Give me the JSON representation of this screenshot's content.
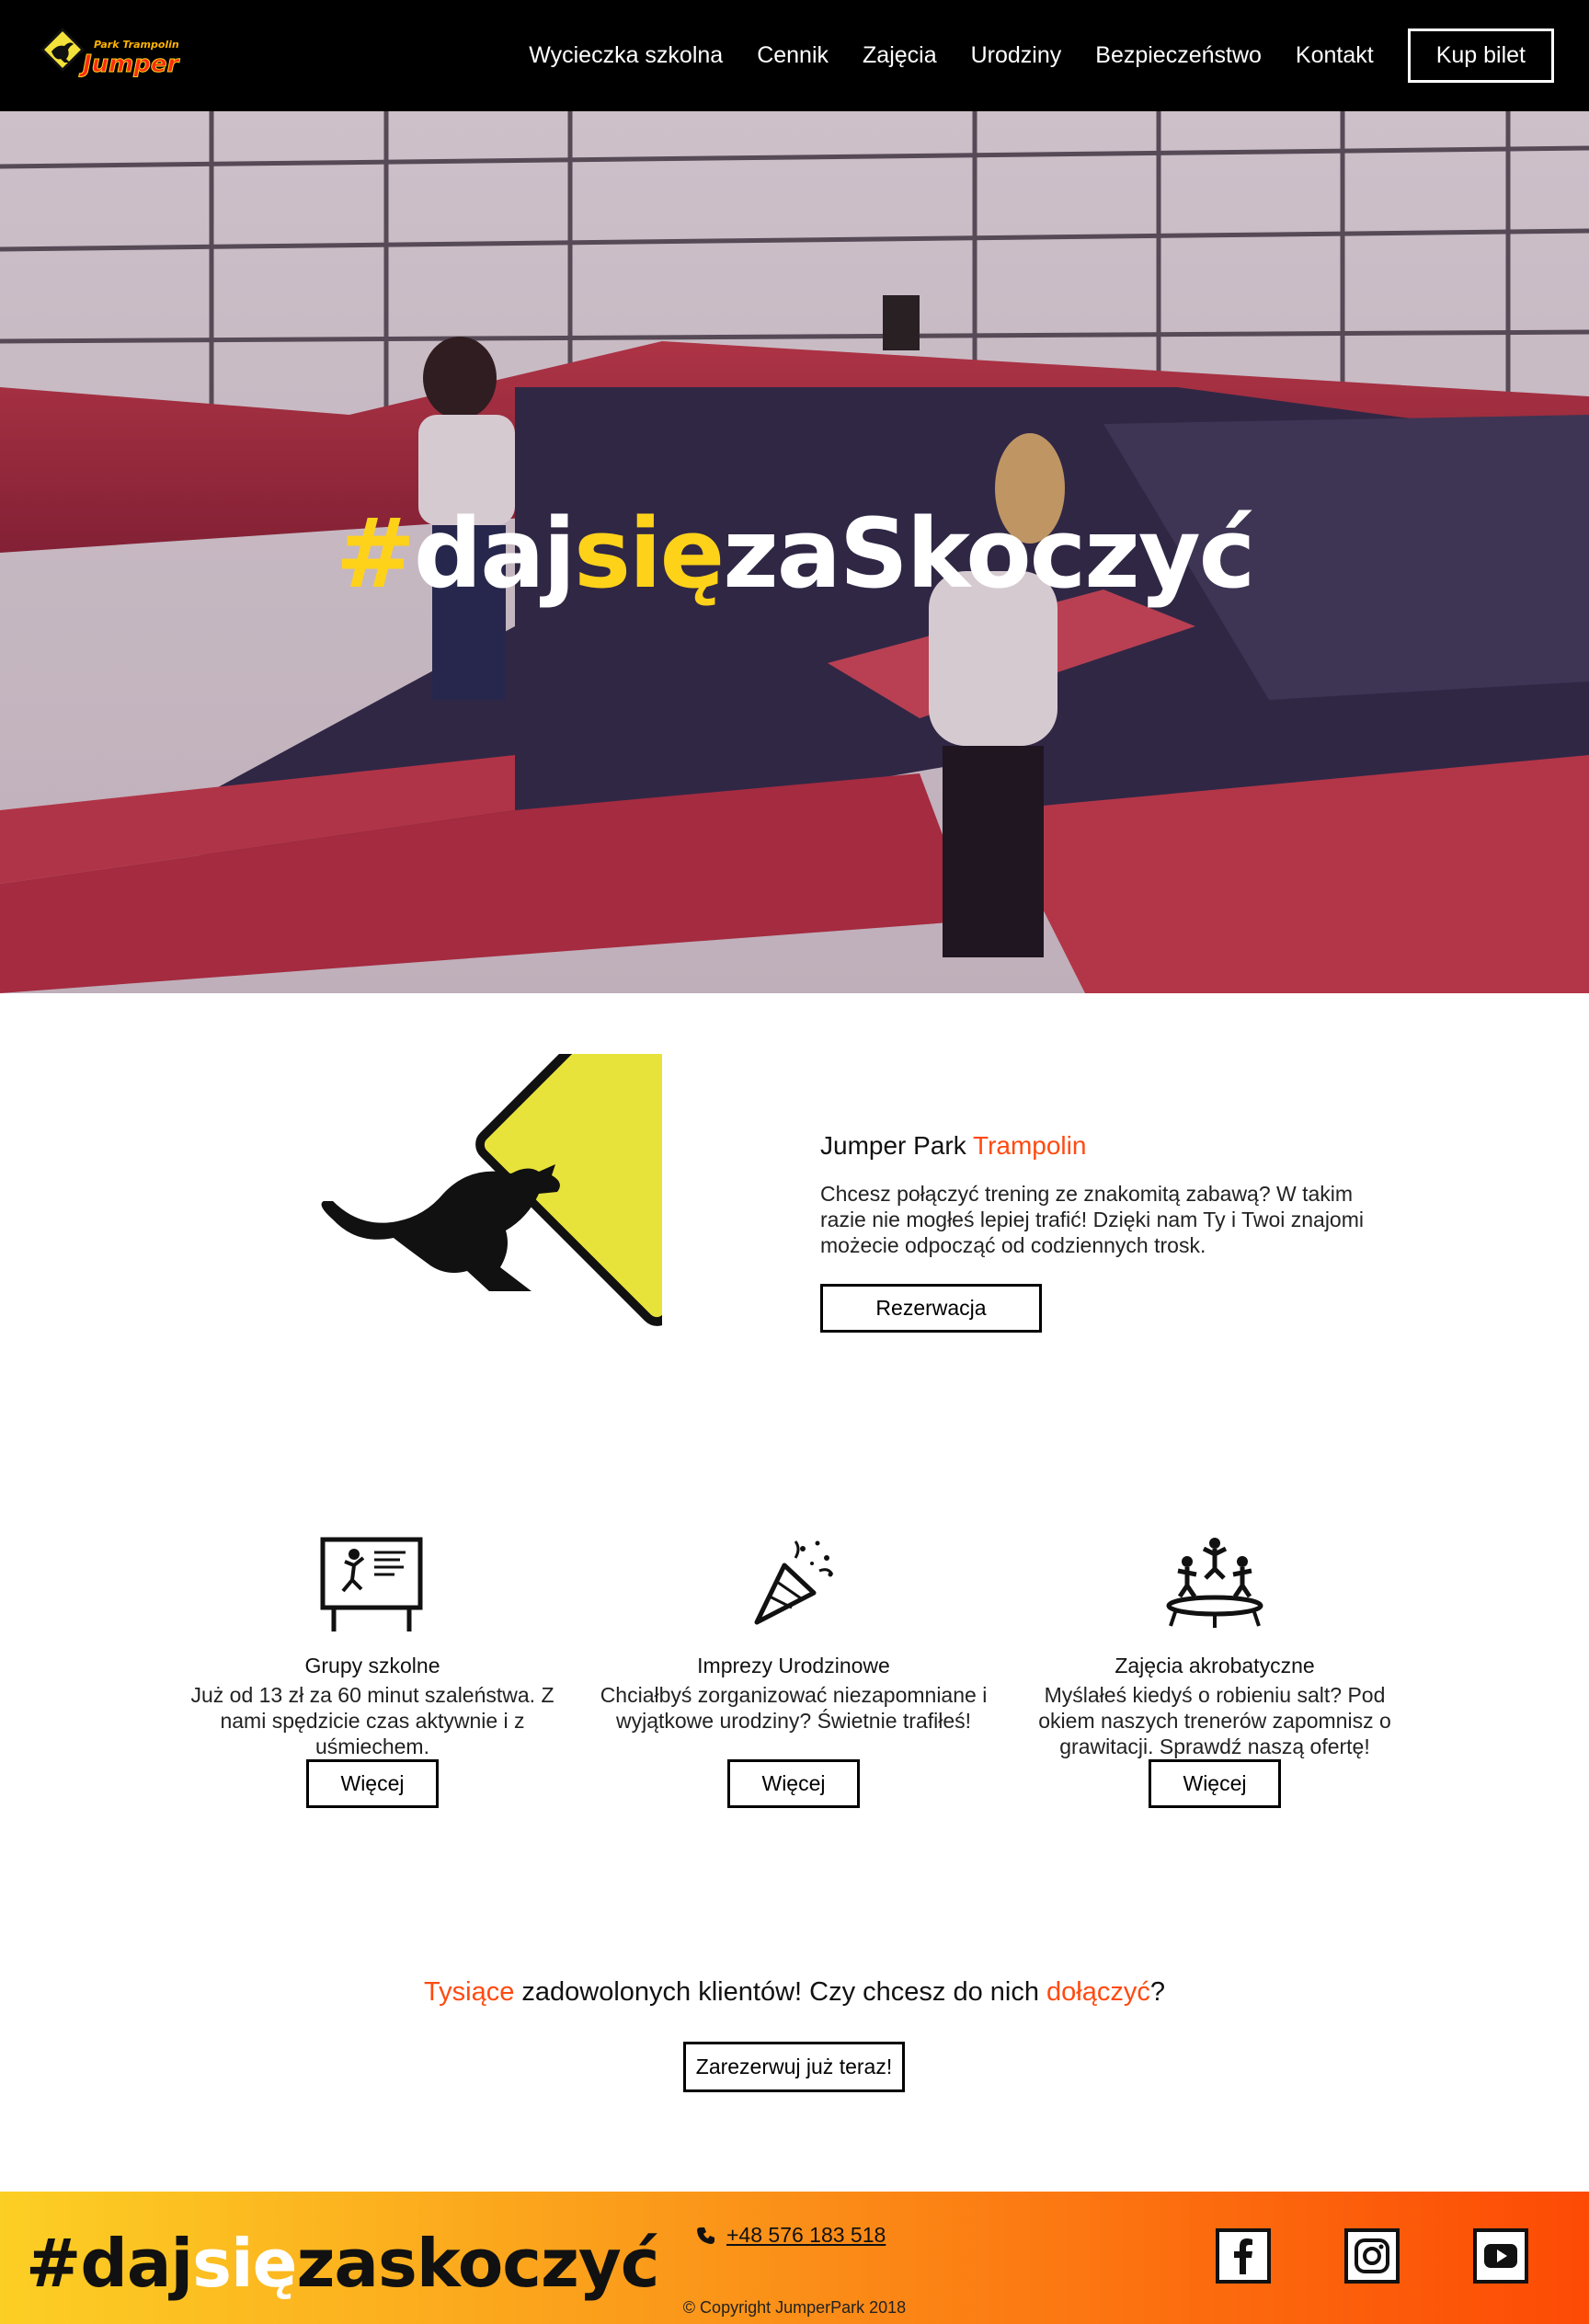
{
  "header": {
    "logo_top": "Park Trampolin",
    "logo_name": "Jumper",
    "nav": [
      "Wycieczka szkolna",
      "Cennik",
      "Zajęcia",
      "Urodziny",
      "Bezpieczeństwo",
      "Kontakt"
    ],
    "buy_label": "Kup bilet"
  },
  "hero": {
    "hash": "#",
    "part1": "daj",
    "part2": "się",
    "part3": "zaSkoczyć"
  },
  "intro": {
    "title_main": "Jumper Park ",
    "title_accent": "Trampolin",
    "text": "Chcesz połączyć trening ze znakomitą zabawą? W takim razie nie mogłeś lepiej trafić! Dzięki nam Ty i Twoi znajomi możecie odpocząć od codziennych trosk.",
    "button": "Rezerwacja"
  },
  "features": [
    {
      "icon": "school-board-icon",
      "title": "Grupy szkolne",
      "text": "Już od 13 zł za 60 minut szaleństwa. Z nami spędzicie czas aktywnie i z uśmiechem.",
      "button": "Więcej"
    },
    {
      "icon": "party-popper-icon",
      "title": "Imprezy Urodzinowe",
      "text": "Chciałbyś zorganizować niezapomniane i wyjątkowe urodziny? Świetnie trafiłeś!",
      "button": "Więcej"
    },
    {
      "icon": "trampoline-kids-icon",
      "title": "Zajęcia akrobatyczne",
      "text": "Myślałeś kiedyś o robieniu salt? Pod okiem naszych trenerów zapomnisz o grawitacji. Sprawdź naszą ofertę!",
      "button": "Więcej"
    }
  ],
  "cta": {
    "accent1": "Tysiące",
    "middle": " zadowolonych klientów! Czy chcesz do nich ",
    "accent2": "dołączyć",
    "end": "?",
    "button": "Zarezerwuj już teraz!"
  },
  "footer": {
    "tag_a": "#daj",
    "tag_b": "się",
    "tag_c": "zaskoczyć",
    "phone": "+48 576 183 518",
    "copyright": "© Copyright JumperPark 2018",
    "social": [
      "facebook-icon",
      "instagram-icon",
      "youtube-icon"
    ]
  },
  "colors": {
    "accent": "#ff4a10",
    "yellow": "#ffd21a",
    "sign_yellow": "#e8e33a"
  }
}
